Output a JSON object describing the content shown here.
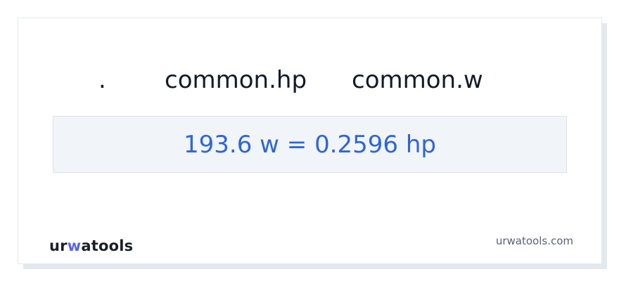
{
  "converter": {
    "header_dot": ".",
    "from_unit": "common.hp",
    "to_unit": "common.w",
    "result": "193.6 w = 0.2596 hp"
  },
  "footer": {
    "logo_prefix": "ur",
    "logo_accent": "w",
    "logo_suffix": "atools",
    "site": "urwatools.com"
  },
  "colors": {
    "accent": "#2e66d6",
    "logo_accent": "#5a63e6",
    "text": "#131b2a",
    "muted": "#57627a",
    "panel_bg": "#f1f4f8"
  }
}
